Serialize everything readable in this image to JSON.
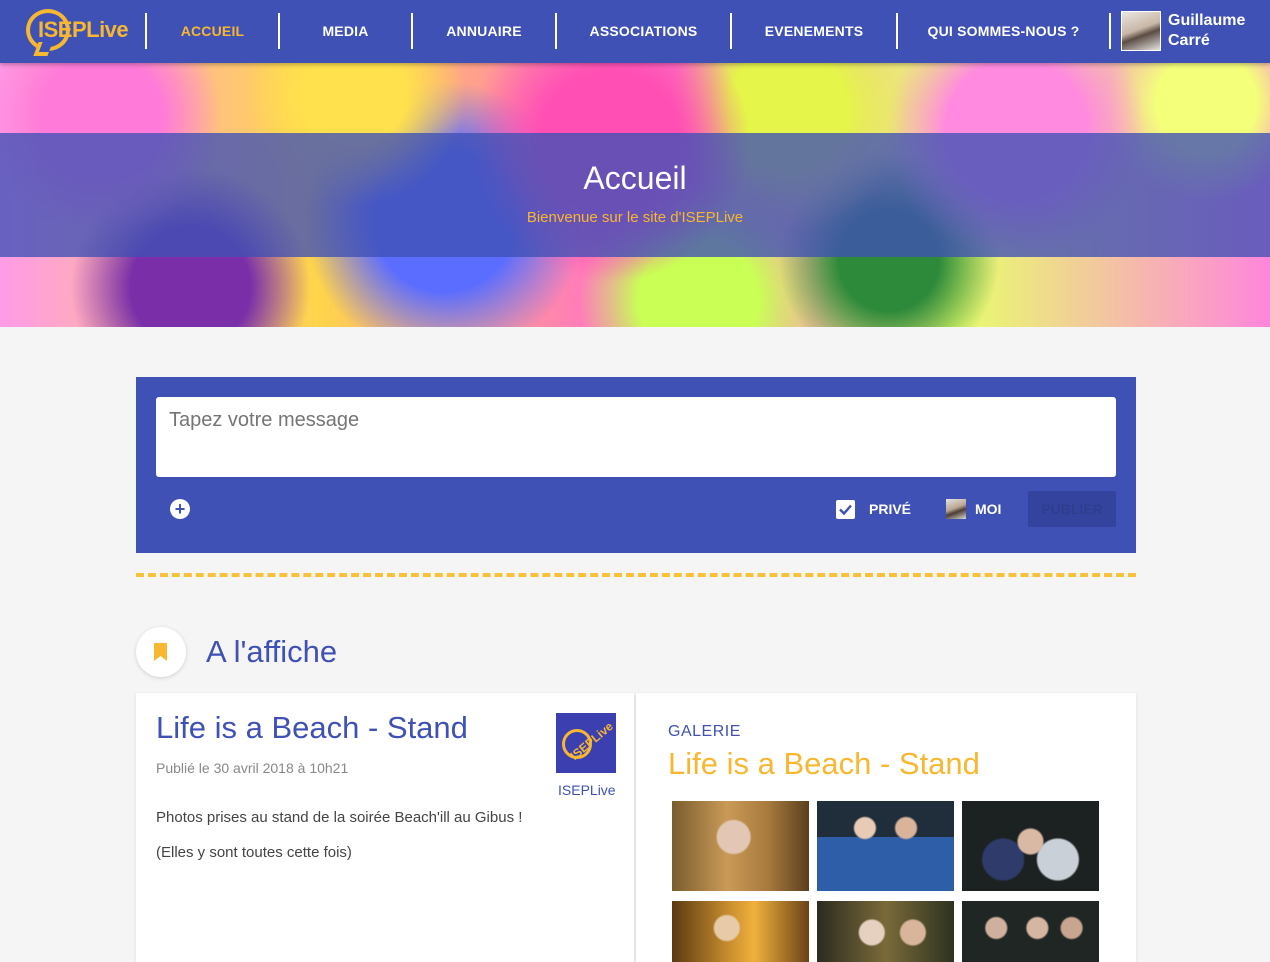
{
  "nav": {
    "logo_text": "ISEPLive",
    "items": [
      {
        "label": "ACCUEIL",
        "active": true
      },
      {
        "label": "MEDIA",
        "active": false
      },
      {
        "label": "ANNUAIRE",
        "active": false
      },
      {
        "label": "ASSOCIATIONS",
        "active": false
      },
      {
        "label": "EVENEMENTS",
        "active": false
      },
      {
        "label": "QUI SOMMES-NOUS ?",
        "active": false
      }
    ],
    "user": {
      "first_name": "Guillaume",
      "last_name": "Carré"
    }
  },
  "hero": {
    "title": "Accueil",
    "subtitle": "Bienvenue sur le site d'ISEPLive"
  },
  "composer": {
    "placeholder": "Tapez votre message",
    "add_icon": "plus-circle-icon",
    "private_label": "PRIVÉ",
    "private_checked": true,
    "author_label": "MOI",
    "publish_label": "PUBLIER"
  },
  "featured": {
    "section_title": "A l'affiche",
    "section_icon": "bookmark-icon",
    "post": {
      "title": "Life is a Beach - Stand",
      "date": "Publié le 30 avril 2018 à 10h21",
      "lines": [
        "Photos prises au stand de la soirée Beach'ill au Gibus !",
        "(Elles y sont toutes cette fois)"
      ],
      "author": "ISEPLive"
    },
    "gallery": {
      "label": "GALERIE",
      "title": "Life is a Beach - Stand"
    }
  },
  "colors": {
    "primary": "#3f51b5",
    "accent": "#f7b731",
    "background": "#f5f5f5"
  }
}
